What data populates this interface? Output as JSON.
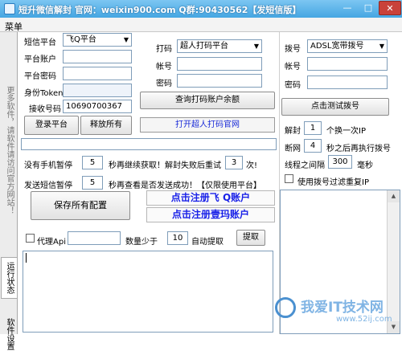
{
  "window": {
    "title": "短升微信解封 官网：weixin900.com Q群:90430562【发短信版】",
    "min": "—",
    "max": "□",
    "close": "✕"
  },
  "menu": {
    "label": "菜单"
  },
  "sidebar": {
    "tabs": [
      {
        "label": "更多软件，请软件请访问官方网站！"
      },
      {
        "label": "运行状态"
      },
      {
        "label": "软件设置"
      }
    ]
  },
  "sms": {
    "platform_label": "短信平台",
    "platform_value": "飞Q平台",
    "account_label": "平台账户",
    "account_value": "",
    "password_label": "平台密码",
    "password_value": "",
    "token_label": "身份Token",
    "token_value": "",
    "receive_label": "接收号码",
    "receive_value": "10690700367",
    "login_button": "登录平台",
    "release_button": "释放所有"
  },
  "captcha": {
    "label": "打码",
    "platform_value": "超人打码平台",
    "account_label": "帐号",
    "account_value": "",
    "password_label": "密码",
    "password_value": "",
    "query_button": "查询打码账户余额",
    "open_site_button": "打开超人打码官网"
  },
  "dial": {
    "label": "拨号",
    "type_value": "ADSL宽带拨号",
    "account_label": "帐号",
    "account_value": "",
    "password_label": "密码",
    "password_value": "",
    "test_button": "点击测试拨号",
    "unblock_label": "解封",
    "unblock_count": "1",
    "unblock_suffix": "个换一次IP",
    "disconnect_label": "断网",
    "disconnect_count": "4",
    "disconnect_suffix": "秒之后再执行拨号",
    "interval_label": "线程之间隔",
    "interval_value": "300",
    "interval_unit": "毫秒",
    "filter_label": "使用拨号过滤重复IP"
  },
  "status_bar": {
    "value": ""
  },
  "timing": {
    "no_phone_label": "没有手机暂停",
    "no_phone_value": "5",
    "no_phone_text": "秒再继续获取！解封失败后重试",
    "retry_value": "3",
    "retry_unit": "次!",
    "send_label": "发送短信暂停",
    "send_value": "5",
    "send_text": "秒再查看是否发送成功！【仅限使用平台】"
  },
  "actions": {
    "save_button": "保存所有配置",
    "register_feiq": "点击注册飞 Q账户",
    "register_yima": "点击注册壹玛账户"
  },
  "proxy": {
    "label": "代理Api",
    "api_value": "",
    "min_label": "数量少于",
    "min_value": "10",
    "auto_label": "自动提取",
    "extract_button": "提取"
  },
  "log": {
    "value": ""
  },
  "dial_log": {
    "value": ""
  },
  "watermark": {
    "text": "我爱IT技术网",
    "url": "www.52ij.com"
  },
  "colors": {
    "accent": "#45a6e2",
    "link": "#1a22e8",
    "close": "#c9423a"
  }
}
